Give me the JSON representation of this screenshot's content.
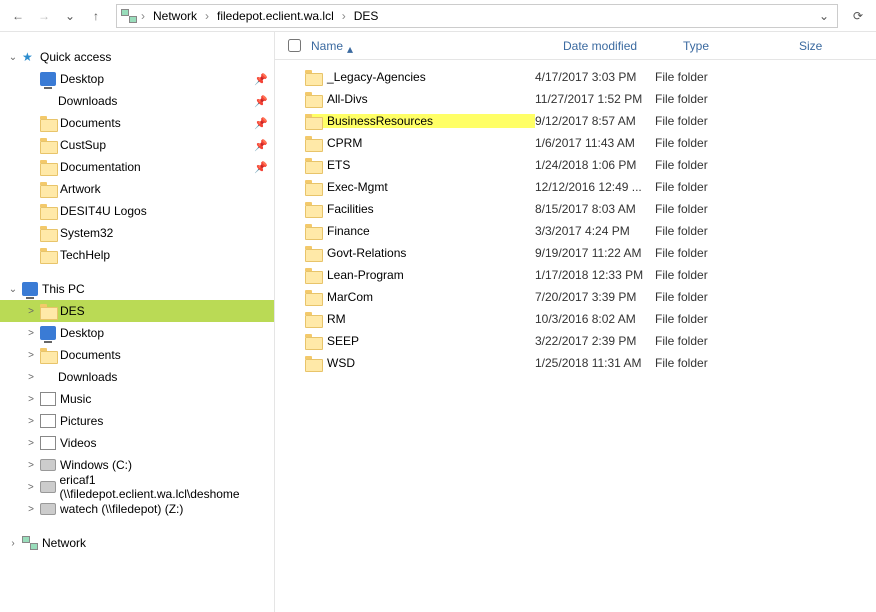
{
  "breadcrumb": [
    "Network",
    "filedepot.eclient.wa.lcl",
    "DES"
  ],
  "nav": {
    "back": "←",
    "forward": "→",
    "up": "↑",
    "dropdown": "⌄",
    "refresh": "⟳"
  },
  "sidebar": {
    "quickAccess": {
      "label": "Quick access",
      "items": [
        {
          "icon": "monitor",
          "label": "Desktop",
          "pinned": true
        },
        {
          "icon": "dl",
          "label": "Downloads",
          "pinned": true
        },
        {
          "icon": "folder",
          "label": "Documents",
          "pinned": true
        },
        {
          "icon": "folder",
          "label": "CustSup",
          "pinned": true
        },
        {
          "icon": "folder",
          "label": "Documentation",
          "pinned": true
        },
        {
          "icon": "folder",
          "label": "Artwork",
          "pinned": false
        },
        {
          "icon": "folder",
          "label": "DESIT4U Logos",
          "pinned": false
        },
        {
          "icon": "folder",
          "label": "System32",
          "pinned": false
        },
        {
          "icon": "folder",
          "label": "TechHelp",
          "pinned": false
        }
      ]
    },
    "thisPC": {
      "label": "This PC",
      "items": [
        {
          "icon": "folder",
          "label": "DES",
          "highlight": true,
          "chev": ">"
        },
        {
          "icon": "monitor",
          "label": "Desktop",
          "chev": ">"
        },
        {
          "icon": "folder",
          "label": "Documents",
          "chev": ">"
        },
        {
          "icon": "dl",
          "label": "Downloads",
          "chev": ">"
        },
        {
          "icon": "music",
          "label": "Music",
          "chev": ">"
        },
        {
          "icon": "pic",
          "label": "Pictures",
          "chev": ">"
        },
        {
          "icon": "video",
          "label": "Videos",
          "chev": ">"
        },
        {
          "icon": "drive",
          "label": "Windows (C:)",
          "chev": ">"
        },
        {
          "icon": "drive",
          "label": "ericaf1 (\\\\filedepot.eclient.wa.lcl\\deshome",
          "chev": ">"
        },
        {
          "icon": "drive",
          "label": "watech (\\\\filedepot) (Z:)",
          "chev": ">"
        }
      ]
    },
    "network": {
      "label": "Network"
    }
  },
  "columns": {
    "name": "Name",
    "date": "Date modified",
    "type": "Type",
    "size": "Size"
  },
  "rows": [
    {
      "name": "_Legacy-Agencies",
      "date": "4/17/2017 3:03 PM",
      "type": "File folder"
    },
    {
      "name": "All-Divs",
      "date": "11/27/2017 1:52 PM",
      "type": "File folder"
    },
    {
      "name": "BusinessResources",
      "date": "9/12/2017 8:57 AM",
      "type": "File folder",
      "hl": true
    },
    {
      "name": "CPRM",
      "date": "1/6/2017 11:43 AM",
      "type": "File folder"
    },
    {
      "name": "ETS",
      "date": "1/24/2018 1:06 PM",
      "type": "File folder"
    },
    {
      "name": "Exec-Mgmt",
      "date": "12/12/2016 12:49 ...",
      "type": "File folder"
    },
    {
      "name": "Facilities",
      "date": "8/15/2017 8:03 AM",
      "type": "File folder"
    },
    {
      "name": "Finance",
      "date": "3/3/2017 4:24 PM",
      "type": "File folder"
    },
    {
      "name": "Govt-Relations",
      "date": "9/19/2017 11:22 AM",
      "type": "File folder"
    },
    {
      "name": "Lean-Program",
      "date": "1/17/2018 12:33 PM",
      "type": "File folder"
    },
    {
      "name": "MarCom",
      "date": "7/20/2017 3:39 PM",
      "type": "File folder"
    },
    {
      "name": "RM",
      "date": "10/3/2016 8:02 AM",
      "type": "File folder"
    },
    {
      "name": "SEEP",
      "date": "3/22/2017 2:39 PM",
      "type": "File folder"
    },
    {
      "name": "WSD",
      "date": "1/25/2018 11:31 AM",
      "type": "File folder"
    }
  ]
}
